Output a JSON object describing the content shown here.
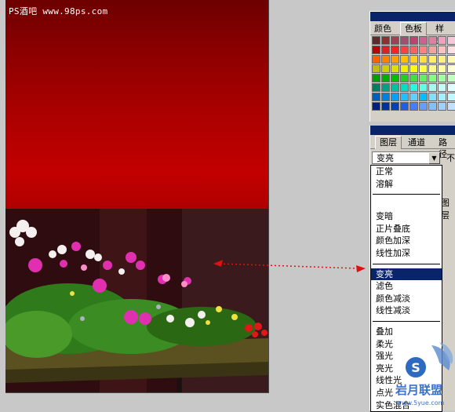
{
  "canvas": {
    "watermark": "PS酒吧 www.98ps.com"
  },
  "swatch_panel": {
    "tabs": [
      "颜色",
      "色板",
      "样式"
    ],
    "active_tab": "色板",
    "swatches": [
      "#5c2a2a",
      "#8c3030",
      "#a04050",
      "#a05070",
      "#c04070",
      "#d06090",
      "#e080a0",
      "#f0a0c0",
      "#f4c8d8",
      "#c00000",
      "#e02020",
      "#ff2020",
      "#ff4040",
      "#ff6060",
      "#ff8080",
      "#ffa0a0",
      "#ffc0c0",
      "#ffe0e0",
      "#ff6000",
      "#ff8000",
      "#ffa000",
      "#ffc000",
      "#ffd020",
      "#ffe040",
      "#fff060",
      "#fff080",
      "#fff8b0",
      "#c0c000",
      "#d0d000",
      "#e0e000",
      "#f0f000",
      "#ffff00",
      "#ffff40",
      "#ffff80",
      "#ffffa0",
      "#ffffd0",
      "#00a000",
      "#00b000",
      "#00c000",
      "#20d020",
      "#40e040",
      "#60f060",
      "#80ff80",
      "#a0ffa0",
      "#c0ffc0",
      "#008060",
      "#00a080",
      "#00c0a0",
      "#00e0c0",
      "#20ffe0",
      "#60ffe8",
      "#a0fff0",
      "#c0fff8",
      "#e0ffff",
      "#0060c0",
      "#0080e0",
      "#00a0ff",
      "#20c0ff",
      "#60d0ff",
      "#00c0ff",
      "#80e0ff",
      "#a0f0ff",
      "#c0f8ff",
      "#002080",
      "#0030a0",
      "#0040c0",
      "#2060e0",
      "#4080ff",
      "#60a0ff",
      "#80c0ff",
      "#a0d0ff",
      "#c0e0ff"
    ]
  },
  "layers_panel": {
    "tabs": [
      "图层",
      "通道",
      "路径"
    ],
    "active_tab": "图层",
    "blend_mode_value": "变亮",
    "opacity_label": "不",
    "side_label": "图层"
  },
  "blend_list": {
    "groups": [
      [
        "正常",
        "溶解"
      ],
      [
        "变暗",
        "正片叠底",
        "颜色加深",
        "线性加深"
      ],
      [
        "变亮",
        "滤色",
        "颜色减淡",
        "线性减淡"
      ],
      [
        "叠加",
        "柔光",
        "强光",
        "亮光",
        "线性光",
        "点光",
        "实色混合"
      ]
    ],
    "selected": "变亮"
  },
  "logo": {
    "text": "岩月联盟",
    "letter": "S",
    "sub": "www.5yue.com"
  }
}
